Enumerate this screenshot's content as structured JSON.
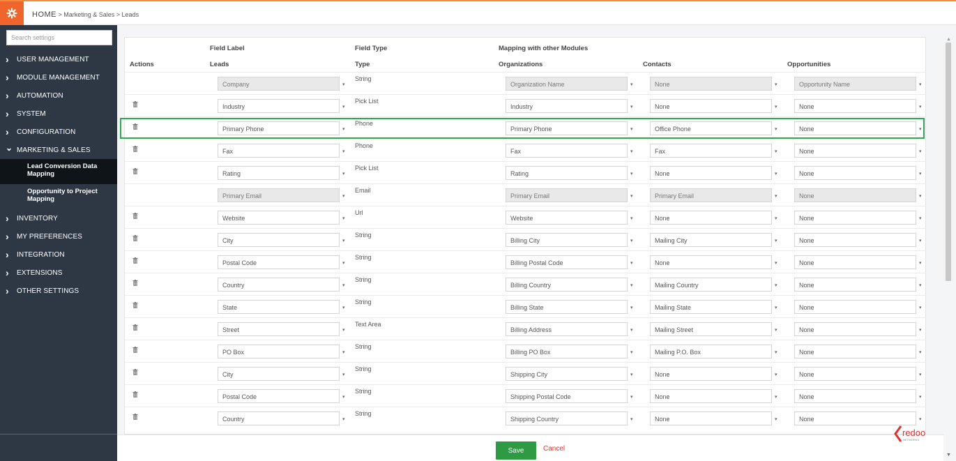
{
  "breadcrumb": {
    "home": "HOME",
    "rest": " > Marketing & Sales > Leads"
  },
  "sidebar": {
    "search_placeholder": "Search settings",
    "items_top": [
      {
        "label": "USER MANAGEMENT"
      },
      {
        "label": "MODULE MANAGEMENT"
      },
      {
        "label": "AUTOMATION"
      },
      {
        "label": "SYSTEM"
      },
      {
        "label": "CONFIGURATION"
      },
      {
        "label": "MARKETING & SALES"
      }
    ],
    "subitems": [
      {
        "label": "Lead Conversion Data Mapping"
      },
      {
        "label": "Opportunity to Project Mapping"
      }
    ],
    "items_bottom": [
      {
        "label": "INVENTORY"
      },
      {
        "label": "MY PREFERENCES"
      },
      {
        "label": "INTEGRATION"
      },
      {
        "label": "EXTENSIONS"
      },
      {
        "label": "OTHER SETTINGS"
      }
    ]
  },
  "table": {
    "header_top": {
      "field_label": "Field Label",
      "field_type": "Field Type",
      "mapping": "Mapping with other Modules"
    },
    "header": {
      "actions": "Actions",
      "leads": "Leads",
      "type": "Type",
      "organizations": "Organizations",
      "contacts": "Contacts",
      "opportunities": "Opportunities"
    },
    "rows": [
      {
        "leads": "Company",
        "type": "String",
        "org": "Organization Name",
        "contacts": "None",
        "opp": "Opportunity Name",
        "deletable": false,
        "ro": true
      },
      {
        "leads": "Industry",
        "type": "Pick List",
        "org": "Industry",
        "contacts": "None",
        "opp": "None",
        "deletable": true,
        "ro": false
      },
      {
        "leads": "Primary Phone",
        "type": "Phone",
        "org": "Primary Phone",
        "contacts": "Office Phone",
        "opp": "None",
        "deletable": true,
        "ro": false
      },
      {
        "leads": "Fax",
        "type": "Phone",
        "org": "Fax",
        "contacts": "Fax",
        "opp": "None",
        "deletable": true,
        "ro": false
      },
      {
        "leads": "Rating",
        "type": "Pick List",
        "org": "Rating",
        "contacts": "None",
        "opp": "None",
        "deletable": true,
        "ro": false
      },
      {
        "leads": "Primary Email",
        "type": "Email",
        "org": "Primary Email",
        "contacts": "Primary Email",
        "opp": "None",
        "deletable": false,
        "ro": true
      },
      {
        "leads": "Website",
        "type": "Url",
        "org": "Website",
        "contacts": "None",
        "opp": "None",
        "deletable": true,
        "ro": false
      },
      {
        "leads": "City",
        "type": "String",
        "org": "Billing City",
        "contacts": "Mailing City",
        "opp": "None",
        "deletable": true,
        "ro": false
      },
      {
        "leads": "Postal Code",
        "type": "String",
        "org": "Billing Postal Code",
        "contacts": "None",
        "opp": "None",
        "deletable": true,
        "ro": false
      },
      {
        "leads": "Country",
        "type": "String",
        "org": "Billing Country",
        "contacts": "Mailing Country",
        "opp": "None",
        "deletable": true,
        "ro": false
      },
      {
        "leads": "State",
        "type": "String",
        "org": "Billing State",
        "contacts": "Mailing State",
        "opp": "None",
        "deletable": true,
        "ro": false
      },
      {
        "leads": "Street",
        "type": "Text Area",
        "org": "Billing Address",
        "contacts": "Mailing Street",
        "opp": "None",
        "deletable": true,
        "ro": false
      },
      {
        "leads": "PO Box",
        "type": "String",
        "org": "Billing PO Box",
        "contacts": "Mailing P.O. Box",
        "opp": "None",
        "deletable": true,
        "ro": false
      },
      {
        "leads": "City",
        "type": "String",
        "org": "Shipping City",
        "contacts": "None",
        "opp": "None",
        "deletable": true,
        "ro": false
      },
      {
        "leads": "Postal Code",
        "type": "String",
        "org": "Shipping Postal Code",
        "contacts": "None",
        "opp": "None",
        "deletable": true,
        "ro": false
      },
      {
        "leads": "Country",
        "type": "String",
        "org": "Shipping Country",
        "contacts": "None",
        "opp": "None",
        "deletable": true,
        "ro": false
      }
    ]
  },
  "footer": {
    "save_label": "Save",
    "cancel_label": "Cancel"
  },
  "logo": {
    "text": "redoo",
    "subtext": "NETWORKS"
  },
  "colors": {
    "accent": "#f0652b",
    "sidebar_bg": "#2e3845",
    "save_green": "#2e9a43",
    "cancel_red": "#e5302d",
    "highlight": "#2fa84f"
  }
}
